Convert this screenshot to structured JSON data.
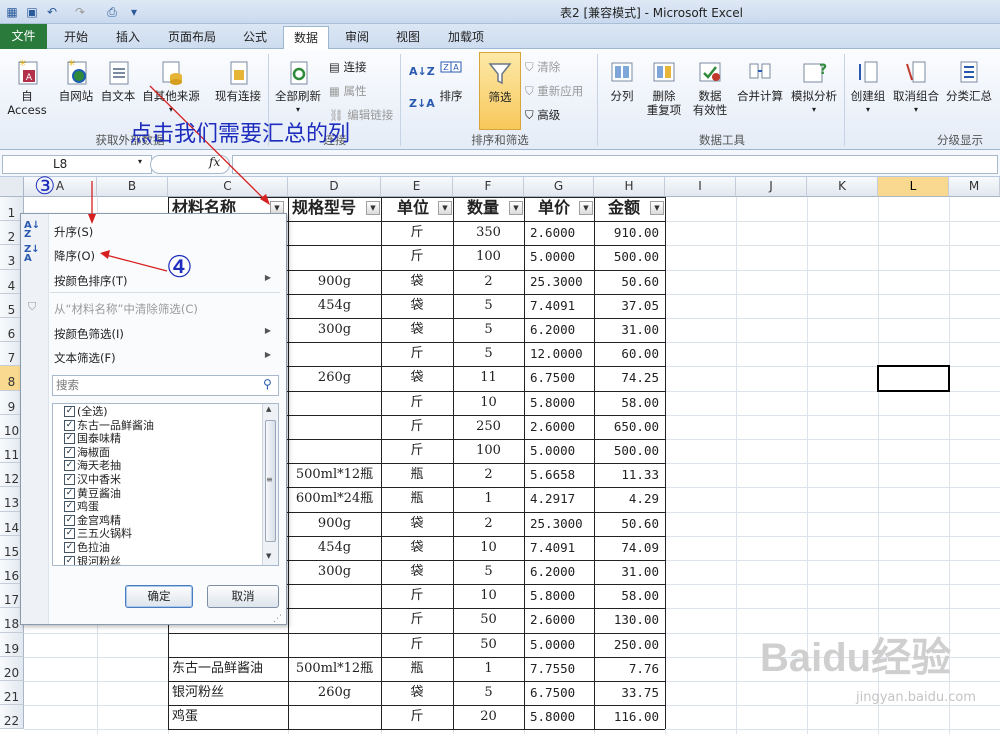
{
  "window": {
    "title": "表2  [兼容模式] - Microsoft Excel"
  },
  "tabs": [
    "文件",
    "开始",
    "插入",
    "页面布局",
    "公式",
    "数据",
    "审阅",
    "视图",
    "加载项"
  ],
  "active_tab": "数据",
  "ribbon": {
    "get_external": {
      "access": "自 Access",
      "web": "自网站",
      "text": "自文本",
      "other": "自其他来源",
      "existing": "现有连接",
      "group": "获取外部数据"
    },
    "connections": {
      "refresh": "全部刷新",
      "conn": "连接",
      "props": "属性",
      "edit_links": "编辑链接",
      "group": "连接"
    },
    "sort_filter": {
      "sort": "排序",
      "filter": "筛选",
      "clear": "清除",
      "reapply": "重新应用",
      "advanced": "高级",
      "group": "排序和筛选"
    },
    "data_tools": {
      "split": "分列",
      "remove_dup_1": "删除",
      "remove_dup_2": "重复项",
      "validation_1": "数据",
      "validation_2": "有效性",
      "consolidate": "合并计算",
      "whatif": "模拟分析",
      "group": "数据工具"
    },
    "outline": {
      "group_btn": "创建组",
      "ungroup": "取消组合",
      "subtotal": "分类汇总",
      "group": "分级显示"
    }
  },
  "formula_bar": {
    "name_box": "L8",
    "fx": "fx"
  },
  "columns": [
    "A",
    "B",
    "C",
    "D",
    "E",
    "F",
    "G",
    "H",
    "I",
    "J",
    "K",
    "L",
    "M"
  ],
  "rows": [
    "1",
    "2",
    "3",
    "4",
    "5",
    "6",
    "7",
    "8",
    "9",
    "10",
    "11",
    "12",
    "13",
    "14",
    "15",
    "16",
    "17",
    "18",
    "19",
    "20",
    "21",
    "22"
  ],
  "selected_cell": {
    "col": "L",
    "row": "8"
  },
  "headers": [
    "材料名称",
    "规格型号",
    "单位",
    "数量",
    "单价",
    "金额"
  ],
  "table": [
    {
      "name": "",
      "spec": "",
      "unit": "斤",
      "qty": "350",
      "price": "2.6000",
      "amount": "910.00"
    },
    {
      "name": "",
      "spec": "",
      "unit": "斤",
      "qty": "100",
      "price": "5.0000",
      "amount": "500.00"
    },
    {
      "name": "",
      "spec": "900g",
      "unit": "袋",
      "qty": "2",
      "price": "25.3000",
      "amount": "50.60"
    },
    {
      "name": "",
      "spec": "454g",
      "unit": "袋",
      "qty": "5",
      "price": "7.4091",
      "amount": "37.05"
    },
    {
      "name": "",
      "spec": "300g",
      "unit": "袋",
      "qty": "5",
      "price": "6.2000",
      "amount": "31.00"
    },
    {
      "name": "",
      "spec": "",
      "unit": "斤",
      "qty": "5",
      "price": "12.0000",
      "amount": "60.00"
    },
    {
      "name": "",
      "spec": "260g",
      "unit": "袋",
      "qty": "11",
      "price": "6.7500",
      "amount": "74.25"
    },
    {
      "name": "",
      "spec": "",
      "unit": "斤",
      "qty": "10",
      "price": "5.8000",
      "amount": "58.00"
    },
    {
      "name": "",
      "spec": "",
      "unit": "斤",
      "qty": "250",
      "price": "2.6000",
      "amount": "650.00"
    },
    {
      "name": "",
      "spec": "",
      "unit": "斤",
      "qty": "100",
      "price": "5.0000",
      "amount": "500.00"
    },
    {
      "name": "",
      "spec": "500ml*12瓶",
      "unit": "瓶",
      "qty": "2",
      "price": "5.6658",
      "amount": "11.33"
    },
    {
      "name": "",
      "spec": "600ml*24瓶",
      "unit": "瓶",
      "qty": "1",
      "price": "4.2917",
      "amount": "4.29"
    },
    {
      "name": "",
      "spec": "900g",
      "unit": "袋",
      "qty": "2",
      "price": "25.3000",
      "amount": "50.60"
    },
    {
      "name": "",
      "spec": "454g",
      "unit": "袋",
      "qty": "10",
      "price": "7.4091",
      "amount": "74.09"
    },
    {
      "name": "",
      "spec": "300g",
      "unit": "袋",
      "qty": "5",
      "price": "6.2000",
      "amount": "31.00"
    },
    {
      "name": "",
      "spec": "",
      "unit": "斤",
      "qty": "10",
      "price": "5.8000",
      "amount": "58.00"
    },
    {
      "name": "",
      "spec": "",
      "unit": "斤",
      "qty": "50",
      "price": "2.6000",
      "amount": "130.00"
    },
    {
      "name": "",
      "spec": "",
      "unit": "斤",
      "qty": "50",
      "price": "5.0000",
      "amount": "250.00"
    },
    {
      "name": "东古一品鲜酱油",
      "spec": "500ml*12瓶",
      "unit": "瓶",
      "qty": "1",
      "price": "7.7550",
      "amount": "7.76"
    },
    {
      "name": "银河粉丝",
      "spec": "260g",
      "unit": "袋",
      "qty": "5",
      "price": "6.7500",
      "amount": "33.75"
    },
    {
      "name": "鸡蛋",
      "spec": "",
      "unit": "斤",
      "qty": "20",
      "price": "5.8000",
      "amount": "116.00"
    }
  ],
  "filter_menu": {
    "sort_asc": "升序(S)",
    "sort_desc": "降序(O)",
    "sort_color": "按颜色排序(T)",
    "clear_filter": "从“材料名称”中清除筛选(C)",
    "color_filter": "按颜色筛选(I)",
    "text_filter": "文本筛选(F)",
    "search_placeholder": "搜索",
    "items": [
      "(全选)",
      "东古一品鲜酱油",
      "国泰味精",
      "海椒面",
      "海天老抽",
      "汉中香米",
      "黄豆酱油",
      "鸡蛋",
      "金宫鸡精",
      "三五火锅料",
      "色拉油",
      "银河粉丝"
    ],
    "ok": "确定",
    "cancel": "取消"
  },
  "annotations": {
    "instruction": "点击我们需要汇总的列",
    "step3": "③",
    "step4": "④"
  },
  "watermark": {
    "brand": "Baidu经验",
    "url": "jingyan.baidu.com"
  }
}
